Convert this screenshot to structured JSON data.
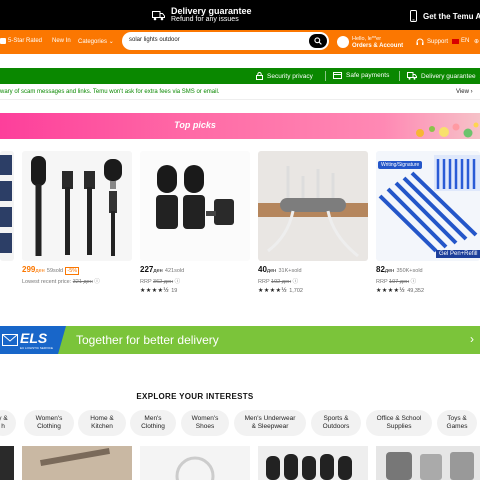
{
  "topbar": {
    "guarantee_title": "Delivery guarantee",
    "guarantee_sub": "Refund for any issues",
    "app_label": "Get the Temu App"
  },
  "nav": {
    "rated": "5-Star Rated",
    "new_in": "New In",
    "categories": "Categories",
    "search_value": "solar lights outdoor",
    "greeting": "Hello, le**er",
    "orders": "Orders & Account",
    "support": "Support",
    "lang": "EN"
  },
  "trustbar": {
    "privacy": "Security privacy",
    "payments": "Safe payments",
    "delivery": "Delivery guarantee"
  },
  "alert": {
    "message": "wary of scam messages and links. Temu won't ask for extra fees via SMS or email.",
    "view": "View"
  },
  "top_picks": {
    "title": "Top picks"
  },
  "products": [
    {
      "price": "299",
      "unit": "ден",
      "sold": "59sold",
      "badge": "-5%",
      "sub_label": "Lowest recent price:",
      "sub_value": "321 ден",
      "stars": "",
      "count": ""
    },
    {
      "price": "227",
      "unit": "ден",
      "sold": "421sold",
      "badge": "",
      "sub_label": "RRP",
      "sub_value": "362 ден",
      "stars": "★★★★½",
      "count": "19"
    },
    {
      "price": "40",
      "unit": "ден",
      "sold": "31K+sold",
      "badge": "",
      "sub_label": "RRP",
      "sub_value": "102 ден",
      "stars": "★★★★½",
      "count": "1,702"
    },
    {
      "price": "82",
      "unit": "ден",
      "sold": "350K+sold",
      "badge": "",
      "sub_label": "RRP",
      "sub_value": "107 ден",
      "stars": "★★★★½",
      "count": "49,352"
    }
  ],
  "product_tags": {
    "writing": "Writing/Signature",
    "gel": "Gel Pen+Refill"
  },
  "els": {
    "logo": "ELS",
    "logo_sub": "EU LOGISTIC SERVICE",
    "tagline": "Together for better delivery"
  },
  "explore": {
    "title": "EXPLORE YOUR INTERESTS",
    "chips": [
      {
        "l1": "y &",
        "l2": "h"
      },
      {
        "l1": "Women's",
        "l2": "Clothing"
      },
      {
        "l1": "Home &",
        "l2": "Kitchen"
      },
      {
        "l1": "Men's",
        "l2": "Clothing"
      },
      {
        "l1": "Women's",
        "l2": "Shoes"
      },
      {
        "l1": "Men's Underwear",
        "l2": "& Sleepwear"
      },
      {
        "l1": "Sports &",
        "l2": "Outdoors"
      },
      {
        "l1": "Office & School",
        "l2": "Supplies"
      },
      {
        "l1": "Toys &",
        "l2": "Games"
      }
    ]
  },
  "colors": {
    "brand_orange": "#fb7701",
    "trust_green": "#0a8800",
    "pink": "#fd3f9b",
    "els_blue": "#1866c9",
    "els_green": "#7bc43a"
  }
}
